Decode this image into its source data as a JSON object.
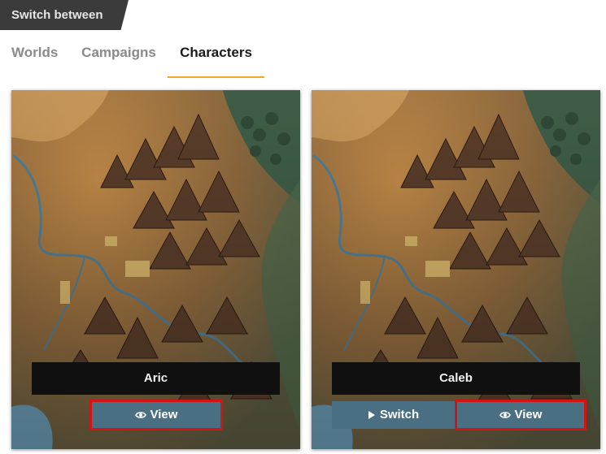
{
  "header": {
    "title": "Switch between"
  },
  "tabs": [
    {
      "label": "Worlds",
      "active": false
    },
    {
      "label": "Campaigns",
      "active": false
    },
    {
      "label": "Characters",
      "active": true
    }
  ],
  "colors": {
    "accent": "#f0a830",
    "button": "#4a6f82",
    "highlight": "#d31414"
  },
  "characters": [
    {
      "name": "Aric",
      "view_label": "View",
      "view_icon": "eye-icon"
    },
    {
      "name": "Caleb",
      "switch_label": "Switch",
      "switch_icon": "play-icon",
      "view_label": "View",
      "view_icon": "eye-icon"
    }
  ]
}
